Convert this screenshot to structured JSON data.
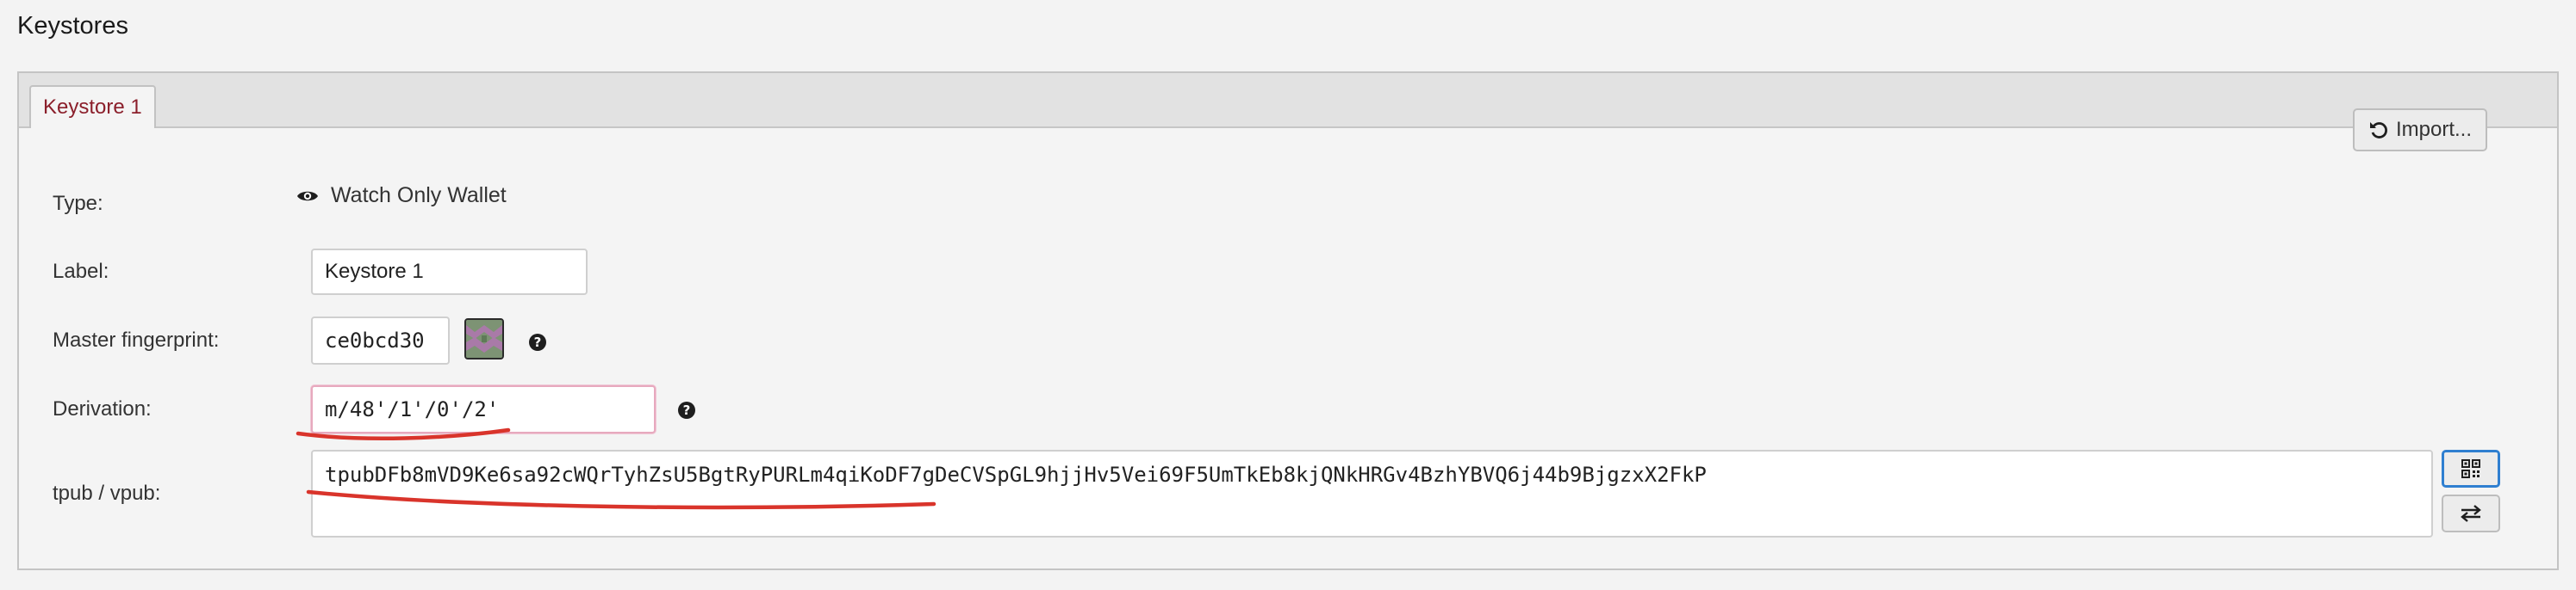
{
  "section": {
    "title": "Keystores"
  },
  "tabs": [
    {
      "label": "Keystore 1"
    }
  ],
  "keystore": {
    "type": {
      "label": "Type:",
      "value": "Watch Only Wallet",
      "icon": "eye-icon"
    },
    "import_button": {
      "label": "Import...",
      "icon": "undo-icon"
    },
    "label_field": {
      "label": "Label:",
      "value": "Keystore 1"
    },
    "fingerprint": {
      "label": "Master fingerprint:",
      "value": "ce0bcd30",
      "help": "?"
    },
    "derivation": {
      "label": "Derivation:",
      "value": "m/48'/1'/0'/2'",
      "help": "?"
    },
    "xpub": {
      "label": "tpub / vpub:",
      "value": "tpubDFb8mVD9Ke6sa92cWQrTyhZsU5BgtRyPURLm4qiKoDF7gDeCVSpGL9hjjHv5Vei69F5UmTkEb8kjQNkHRGv4BzhYBVQ6j44b9BjgzxX2FkP",
      "buttons": [
        {
          "icon": "qr-code-icon"
        },
        {
          "icon": "swap-arrows-icon"
        }
      ]
    }
  },
  "colors": {
    "annotation_red": "#d9342b",
    "tab_text": "#8b1f2b",
    "focus_blue": "#2f7fd0",
    "invalid_border": "#e7a9be"
  }
}
